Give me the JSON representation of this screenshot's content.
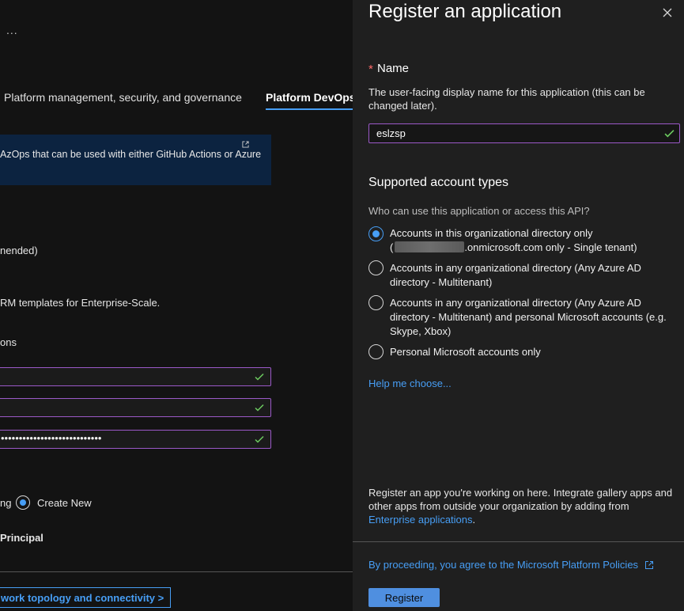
{
  "background_page": {
    "more_label": "...",
    "tabs": [
      {
        "label": "Platform management, security, and governance"
      },
      {
        "label": "Platform DevOps"
      }
    ],
    "banner_text": "AzOps that can be used with either GitHub Actions or Azure",
    "texts": {
      "recommended_fragment": "nended)",
      "arm_fragment": "RM templates for Enterprise-Scale.",
      "options_fragment": "ons",
      "existing_fragment": "ng",
      "create_new_label": "Create New",
      "principal_fragment": "Principal"
    },
    "password_mask": "••••••••••••••••••••••••••••",
    "next_button": "work topology and connectivity >"
  },
  "panel": {
    "title": "Register an application",
    "name_field": {
      "required_mark": "*",
      "label": "Name",
      "description": "The user-facing display name for this application (this can be changed later).",
      "value": "eslzsp"
    },
    "account_types": {
      "heading": "Supported account types",
      "question": "Who can use this application or access this API?",
      "options": [
        {
          "line1": "Accounts in this organizational directory only",
          "line2_prefix": "(",
          "line2_suffix": ".onmicrosoft.com only - Single tenant)",
          "selected": true
        },
        {
          "label": "Accounts in any organizational directory (Any Azure AD directory - Multitenant)",
          "selected": false
        },
        {
          "label": "Accounts in any organizational directory (Any Azure AD directory - Multitenant) and personal Microsoft accounts (e.g. Skype, Xbox)",
          "selected": false
        },
        {
          "label": "Personal Microsoft accounts only",
          "selected": false
        }
      ],
      "help_link": "Help me choose..."
    },
    "footer": {
      "note": "Register an app you're working on here. Integrate gallery apps and other apps from outside your organization by adding from",
      "note_link": "Enterprise applications",
      "note_end": ".",
      "policy_link": "By proceeding, you agree to the Microsoft Platform Policies",
      "register_button": "Register"
    }
  },
  "colors": {
    "accent": "#479ef5",
    "valid_border": "#9b59c8",
    "valid_check": "#6ccb5f",
    "panel_bg": "#1f1f1f",
    "page_bg": "#131313",
    "banner_bg": "#0c2340"
  }
}
